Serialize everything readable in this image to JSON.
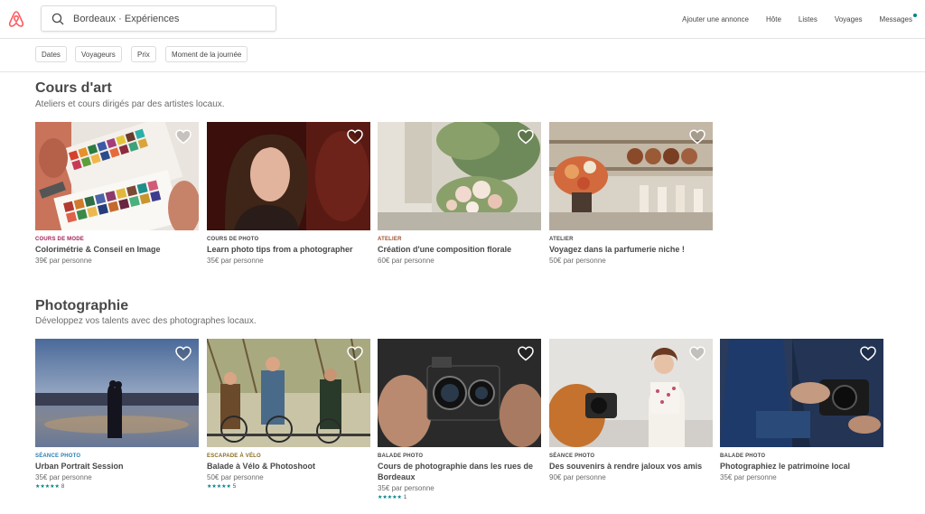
{
  "header": {
    "search_value": "Bordeaux · Expériences",
    "nav": [
      "Ajouter une annonce",
      "Hôte",
      "Listes",
      "Voyages",
      "Messages"
    ]
  },
  "filters": [
    "Dates",
    "Voyageurs",
    "Prix",
    "Moment de la journée"
  ],
  "sections": [
    {
      "title": "Cours d'art",
      "subtitle": "Ateliers et cours dirigés par des artistes locaux.",
      "cards": [
        {
          "category": "COURS DE MODE",
          "category_color": "#a61d55",
          "title": "Colorimétrie & Conseil en Image",
          "price": "39€ par personne"
        },
        {
          "category": "COURS DE PHOTO",
          "category_color": "#484848",
          "title": "Learn photo tips from a photographer",
          "price": "35€ par personne"
        },
        {
          "category": "ATELIER",
          "category_color": "#a0522d",
          "title": "Création d'une composition florale",
          "price": "60€ par personne"
        },
        {
          "category": "ATELIER",
          "category_color": "#484848",
          "title": "Voyagez dans la parfumerie niche !",
          "price": "50€ par personne"
        }
      ]
    },
    {
      "title": "Photographie",
      "subtitle": "Développez vos talents avec des photographes locaux.",
      "cards": [
        {
          "category": "SÉANCE PHOTO",
          "category_color": "#2b7fb5",
          "title": "Urban Portrait Session",
          "price": "35€ par personne",
          "stars": "★★★★★",
          "reviews": "8"
        },
        {
          "category": "ESCAPADE À VÉLO",
          "category_color": "#8a6d1f",
          "title": "Balade à Vélo & Photoshoot",
          "price": "50€ par personne",
          "stars": "★★★★★",
          "reviews": "5"
        },
        {
          "category": "BALADE PHOTO",
          "category_color": "#484848",
          "title": "Cours de photographie dans les rues de Bordeaux",
          "price": "35€ par personne",
          "stars": "★★★★★",
          "reviews": "1"
        },
        {
          "category": "SÉANCE PHOTO",
          "category_color": "#484848",
          "title": "Des souvenirs à rendre jaloux vos amis",
          "price": "90€ par personne"
        },
        {
          "category": "BALADE PHOTO",
          "category_color": "#484848",
          "title": "Photographiez le patrimoine local",
          "price": "35€ par personne"
        }
      ]
    }
  ]
}
